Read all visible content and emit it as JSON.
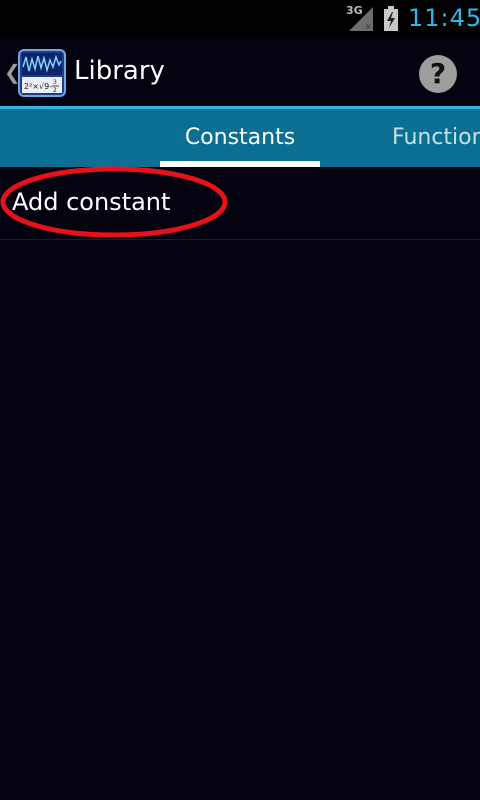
{
  "status_bar": {
    "network": "3G",
    "time": "11:45"
  },
  "action_bar": {
    "title": "Library",
    "help_label": "?"
  },
  "tabs": [
    {
      "label": "Constants"
    },
    {
      "label": "Function"
    }
  ],
  "list": {
    "items": [
      {
        "label": "Add constant"
      }
    ]
  },
  "colors": {
    "accent": "#33b5e5",
    "tab_background": "#0b6f94",
    "background": "#03030f",
    "annotation": "#e8101a"
  },
  "icons": [
    "chevron-left-icon",
    "app-icon",
    "help-icon",
    "signal-icon",
    "battery-icon"
  ]
}
